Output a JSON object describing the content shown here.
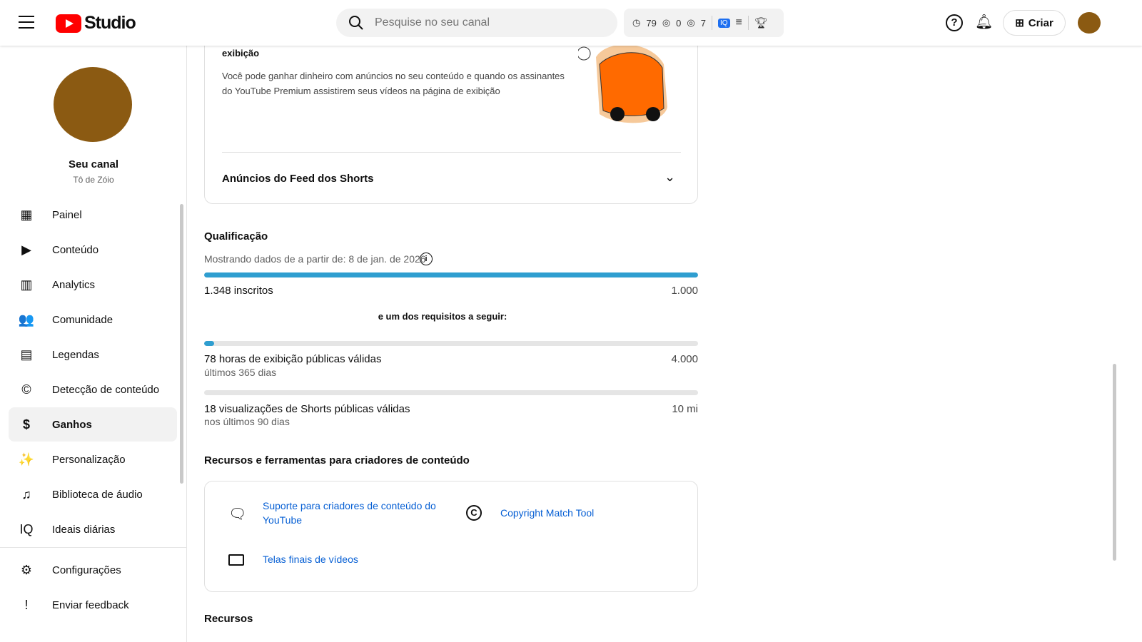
{
  "header": {
    "logo_text": "Studio",
    "search_placeholder": "Pesquise no seu canal",
    "ext_stats": [
      "79",
      "0",
      "7"
    ],
    "create_label": "Criar"
  },
  "sidebar": {
    "channel_title": "Seu canal",
    "channel_name": "Tô de Zóio",
    "items": [
      {
        "label": "Painel",
        "icon": "▦"
      },
      {
        "label": "Conteúdo",
        "icon": "▶"
      },
      {
        "label": "Analytics",
        "icon": "▥"
      },
      {
        "label": "Comunidade",
        "icon": "👥"
      },
      {
        "label": "Legendas",
        "icon": "▤"
      },
      {
        "label": "Detecção de conteúdo",
        "icon": "©"
      },
      {
        "label": "Ganhos",
        "icon": "$"
      },
      {
        "label": "Personalização",
        "icon": "✨"
      },
      {
        "label": "Biblioteca de áudio",
        "icon": "♫"
      },
      {
        "label": "Ideais diárias",
        "icon": "IQ"
      }
    ],
    "bottom": [
      {
        "label": "Configurações",
        "icon": "⚙"
      },
      {
        "label": "Enviar feedback",
        "icon": "!"
      }
    ]
  },
  "main": {
    "ads_title": "exibição",
    "ads_desc": "Você pode ganhar dinheiro com anúncios no seu conteúdo e quando os assinantes do YouTube Premium assistirem seus vídeos na página de exibição",
    "shorts_ads": "Anúncios do Feed dos Shorts",
    "qual_title": "Qualificação",
    "qual_date": "Mostrando dados de a partir de: 8 de jan. de 2026",
    "subs_label": "1.348 inscritos",
    "subs_goal": "1.000",
    "subs_progress": 1.0,
    "req_text": "e um dos requisitos a seguir:",
    "hours_label": "78 horas de exibição públicas válidas",
    "hours_sub": "últimos 365 dias",
    "hours_goal": "4.000",
    "hours_progress": 0.0195,
    "shorts_label": "18 visualizações de Shorts públicas válidas",
    "shorts_sub": "nos últimos 90 dias",
    "shorts_goal": "10 mi",
    "shorts_progress": 1.8e-06,
    "tools_title": "Recursos e ferramentas para criadores de conteúdo",
    "tool_support": "Suporte para criadores de conteúdo do YouTube",
    "tool_copyright": "Copyright Match Tool",
    "tool_endscreens": "Telas finais de vídeos",
    "resources_title": "Recursos"
  }
}
